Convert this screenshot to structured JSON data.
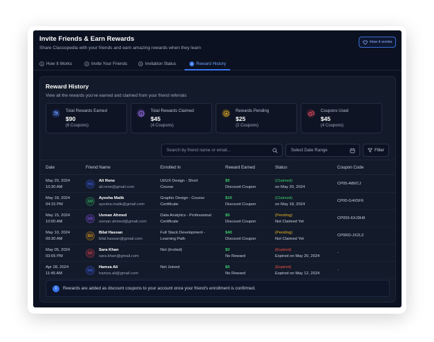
{
  "header": {
    "title": "Invite Friends & Earn Rewards",
    "subtitle": "Share Classopedia with your friends and earn amazing rewards when they learn",
    "how_it_works_label": "How it works"
  },
  "tabs": [
    {
      "num": "1",
      "label": "How It Works"
    },
    {
      "num": "2",
      "label": "Invite Your Friends"
    },
    {
      "num": "3",
      "label": "Invitation Status"
    },
    {
      "num": "4",
      "label": "Reward History",
      "active": true
    }
  ],
  "history": {
    "title": "Reward History",
    "subtitle": "View all the rewards you've earned and claimed from your friend referrals"
  },
  "stats": [
    {
      "label": "Total Rewards Earned",
      "value": "$90",
      "count": "(6 Coupons)",
      "icon": "users-icon",
      "color": "#4a7dff"
    },
    {
      "label": "Total Rewards Claimed",
      "value": "$45",
      "count": "(4 Coupons)",
      "icon": "dollar-icon",
      "color": "#9b59ff"
    },
    {
      "label": "Rewards Pending",
      "value": "$25",
      "count": "(2 Coupons)",
      "icon": "star-icon",
      "color": "#e6a817"
    },
    {
      "label": "Coupons Used",
      "value": "$45",
      "count": "(4 Coupons)",
      "icon": "ticket-icon",
      "color": "#e8384f"
    }
  ],
  "controls": {
    "search_placeholder": "Search by friend name or email...",
    "date_placeholder": "Select Date Range",
    "filter_label": "Filter"
  },
  "table": {
    "columns": [
      "Date",
      "Friend Name",
      "Enrolled In",
      "Reward Earned",
      "Status",
      "Coupon Code"
    ],
    "rows": [
      {
        "date": "May 20, 2024",
        "time": "10:30 AM",
        "initials": "HA",
        "avatar_color": "#3a5bd9",
        "name": "Ali Rene",
        "email": "ali.rene@gmail.com",
        "course1": "UI/UX Design - Short",
        "course2": "Course",
        "reward": "$5",
        "reward_type": "Discount Coupon",
        "status": "(Claimed)",
        "status_kind": "claimed",
        "status_detail": "on May 20, 2024",
        "code": "CP05-AB0CJ"
      },
      {
        "date": "May 18, 2024",
        "time": "04:15 PM",
        "initials": "AM",
        "avatar_color": "#2e9e5b",
        "name": "Ayesha Malik",
        "email": "ayesha.malik@gmail.com",
        "course1": "Graphic Design - Course",
        "course2": "Certificate",
        "reward": "$10",
        "reward_type": "Discount Coupon",
        "status": "(Claimed)",
        "status_kind": "claimed",
        "status_detail": "on May 18, 2024",
        "code": "CP00-G4X5F6"
      },
      {
        "date": "May 15, 2024",
        "time": "10:00 AM",
        "initials": "UA",
        "avatar_color": "#7b4fd6",
        "name": "Usman Ahmed",
        "email": "usman.ahmed@gmail.com",
        "course1": "Data Analytics - Professional",
        "course2": "Certificate",
        "reward": "$5",
        "reward_type": "Discount Coupon",
        "status": "(Pending)",
        "status_kind": "pending",
        "status_detail": "Not Claimed Yet",
        "code": "CP055-6XJ9H9"
      },
      {
        "date": "May 10, 2024",
        "time": "09:30 AM",
        "initials": "BH",
        "avatar_color": "#c98a1a",
        "name": "Bilal Hassan",
        "email": "bilal.hassan@gmail.com",
        "course1": "Full Stack Development -",
        "course2": "Learning Path",
        "reward": "$40",
        "reward_type": "Discount Coupon",
        "status": "(Pending)",
        "status_kind": "pending",
        "status_detail": "Not Claimed Yet",
        "code": "CP0RD-JX2L3"
      },
      {
        "date": "May 05, 2024",
        "time": "03:05 PM",
        "initials": "SK",
        "avatar_color": "#c93a4a",
        "name": "Sara Khan",
        "email": "sara.khan@gmail.com",
        "course1": "Not (Invited)",
        "course2": "",
        "reward": "$0",
        "reward_type": "No Reward",
        "status": "(Expired)",
        "status_kind": "expired",
        "status_detail": "Expired on May 20, 2024",
        "code": "-"
      },
      {
        "date": "Apr 28, 2024",
        "time": "11:45 AM",
        "initials": "HA",
        "avatar_color": "#3a5bd9",
        "name": "Hamza Ali",
        "email": "hamza.ali@gmail.com",
        "course1": "Not Joined",
        "course2": "",
        "reward": "$0",
        "reward_type": "No Reward",
        "status": "(Expired)",
        "status_kind": "expired",
        "status_detail": "Expired on May 12, 2024",
        "code": "-"
      }
    ]
  },
  "info_text": "Rewards are added as discount coupons to your account once your friend's enrollment is confirmed.",
  "colors": {
    "accent": "#3a76f0",
    "background": "#0b1120",
    "claimed": "#3ecf6c",
    "pending": "#e6b422",
    "expired": "#f0513f"
  }
}
